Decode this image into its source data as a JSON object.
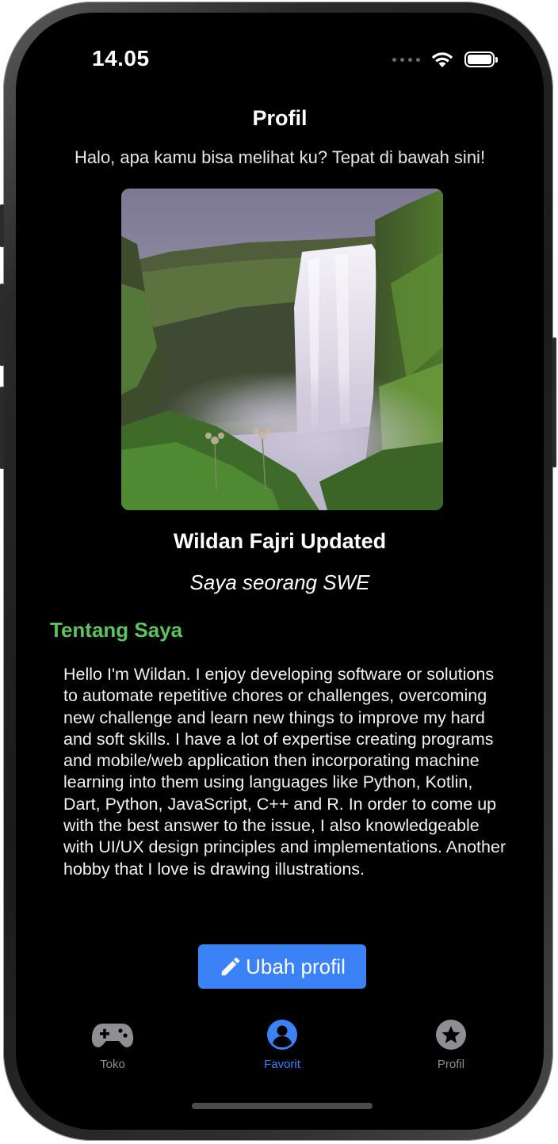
{
  "status_bar": {
    "time": "14.05"
  },
  "header": {
    "title": "Profil",
    "subtitle": "Halo, apa kamu bisa melihat ku? Tepat di bawah sini!"
  },
  "profile": {
    "name": "Wildan Fajri Updated",
    "tagline": "Saya seorang SWE",
    "image": "waterfall-photo"
  },
  "about": {
    "title": "Tentang Saya",
    "body": "Hello I'm Wildan. I enjoy developing software or solutions to automate repetitive chores or challenges, overcoming new challenge and learn new things to improve my hard and soft skills. I have a lot of expertise creating programs and mobile/web application then incorporating machine learning into them using languages like Python, Kotlin, Dart, Python, JavaScript, C++ and R. In order to come up with the best answer to the issue, I also knowledgeable with UI/UX design principles and implementations. Another hobby that I love is drawing illustrations."
  },
  "edit_button": {
    "label": "Ubah profil",
    "icon": "pencil-icon"
  },
  "tabs": [
    {
      "label": "Toko",
      "icon": "gamepad-icon",
      "active": false
    },
    {
      "label": "Favorit",
      "icon": "person-circle-icon",
      "active": true
    },
    {
      "label": "Profil",
      "icon": "star-circle-icon",
      "active": false
    }
  ],
  "colors": {
    "accent": "#3b82f6",
    "section_title": "#5cc35f",
    "tab_inactive": "#8e8e93",
    "background": "#000000"
  }
}
